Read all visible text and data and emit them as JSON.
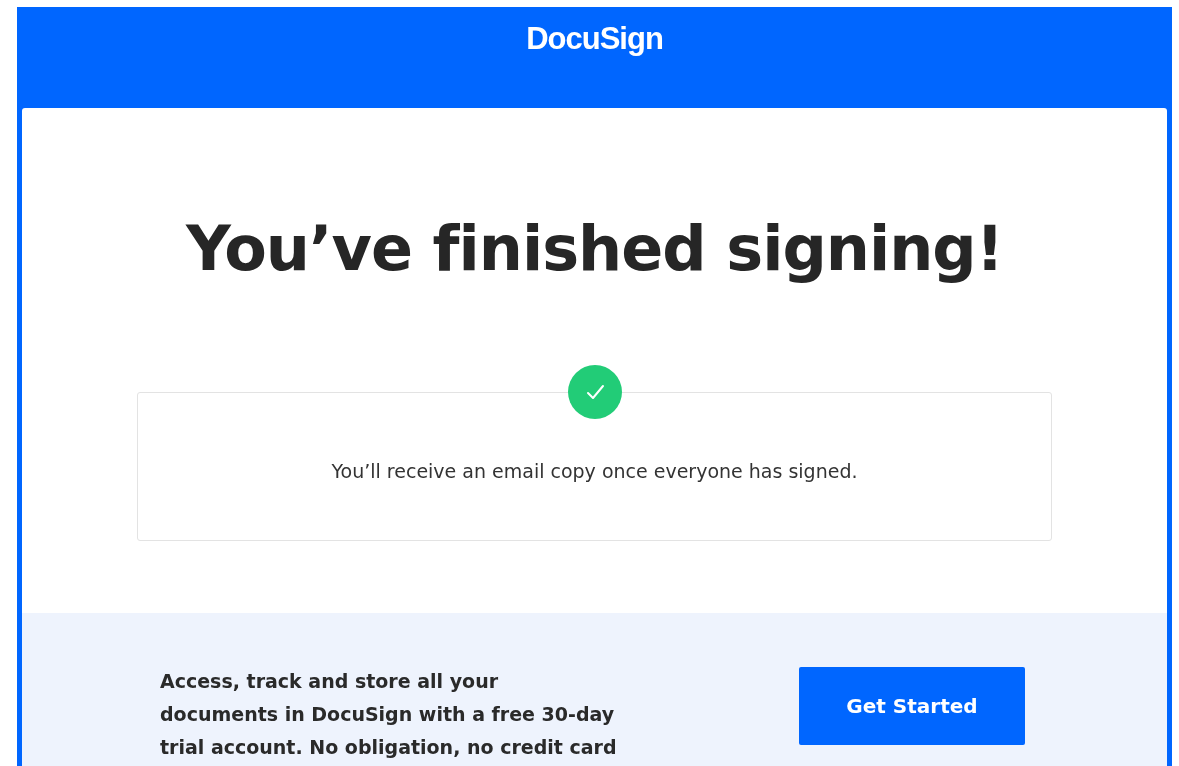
{
  "header": {
    "logo": "DocuSign"
  },
  "main": {
    "title": "You’ve finished signing!",
    "status": {
      "kind": "success",
      "message": "You’ll receive an email copy once everyone has signed."
    }
  },
  "promo": {
    "text": "Access, track and store all your documents in DocuSign with a free 30-day trial account. No obligation, no credit card",
    "button": "Get Started"
  }
}
